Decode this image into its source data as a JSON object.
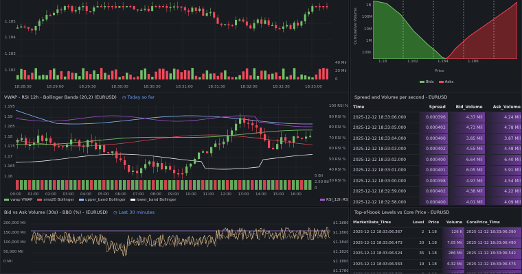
{
  "colors": {
    "up": "#73bf69",
    "down": "#f2495c",
    "vwap": "#73bf69",
    "sma20": "#f2495c",
    "upper": "#8ab8ff",
    "lower": "#ffffff",
    "rsi": "#a352cc",
    "volume": "#e8c89a",
    "cell_hi": "#6a3a94"
  },
  "top_chart": {
    "y_ticks": [
      "1.185",
      "1.184",
      "1.183",
      "1.182"
    ],
    "y_right_ticks": [
      "40 Mil",
      "20 Mil",
      "0"
    ],
    "x_ticks": [
      "18:28:30",
      "18:29:00",
      "18:29:30",
      "18:30:00",
      "18:30:30",
      "18:31:00",
      "18:31:30",
      "18:32:00",
      "18:32:30",
      "18:33:00"
    ]
  },
  "depth_chart": {
    "ylabel": "Cumulative Volume",
    "y_ticks": [
      "1B",
      "100M",
      "10M",
      "1M",
      "100k"
    ],
    "x_ticks": [
      "1.18",
      "1.182",
      "1.184",
      "1.186"
    ],
    "xlabel": "Price",
    "legend": [
      "Bids",
      "Asks"
    ]
  },
  "vwap_panel": {
    "title": "VWAP - RSI 12h - Bollinger Bands (20,2) (EURUSD)",
    "link": "Today so far",
    "y_ticks": [
      "1.195",
      "1.19",
      "1.185",
      "1.18",
      "1.175",
      "1.17",
      "1.165",
      "1.16"
    ],
    "rsi_ticks": [
      "100 RSI %",
      "90 RSI %",
      "80 RSI %",
      "70 RSI %",
      "60 RSI %",
      "50 RSI %",
      "40 RSI %",
      "30 RSI %"
    ],
    "vol_ticks": [
      "5 Bil",
      "2.50 Bil",
      "0"
    ],
    "x_ticks": [
      "00:00",
      "01:00",
      "02:00",
      "03:00",
      "04:00",
      "05:00",
      "06:00",
      "07:00",
      "08:00",
      "09:00",
      "10:00",
      "11:00",
      "12:00",
      "13:00",
      "14:00",
      "15:00",
      "16:00"
    ],
    "legend": [
      "vwap VWAP",
      "sma20 Bollinger",
      "upper_band Bollinger",
      "lower_band Bollinger"
    ],
    "legend_right": "RSI_12h RSI"
  },
  "bidask_panel": {
    "title": "Bid vs Ask Volume (30s) - BBO (%) - (EURUSD)",
    "link": "Last 30 minutes",
    "y_ticks": [
      "200,000 Mil",
      "150,000 Mil",
      "100,000 Mil",
      "50,000 Mil",
      "0 Mil"
    ],
    "y_right_ticks": [
      "$1.1880",
      "$1.1860",
      "$1.1840",
      "$1.1820",
      "$1.1800",
      "$1.1780"
    ]
  },
  "spread_table": {
    "title": "Spread and Volume per second - EURUSD",
    "columns": [
      "Time",
      "Spread",
      "Bid_Volume",
      "Ask_Volume"
    ],
    "rows": [
      [
        "2025-12-12 18:33:06.000",
        "0.000396",
        "4.37 Mil",
        "4.24 Mil"
      ],
      [
        "2025-12-12 18:33:05.000",
        "0.000402",
        "4.73 Mil",
        "4.78 Mil"
      ],
      [
        "2025-12-12 18:33:04.000",
        "0.000400",
        "3.85 Mil",
        "3.87 Mil"
      ],
      [
        "2025-12-12 18:33:03.000",
        "0.000402",
        "4.55 Mil",
        "4.48 Mil"
      ],
      [
        "2025-12-12 18:33:02.000",
        "0.000400",
        "6.64 Mil",
        "6.40 Mil"
      ],
      [
        "2025-12-12 18:33:01.000",
        "0.000401",
        "6.05 Mil",
        "5.91 Mil"
      ],
      [
        "2025-12-12 18:33:00.000",
        "0.000398",
        "4.97 Mil",
        "4.54 Mil"
      ],
      [
        "2025-12-12 18:32:59.000",
        "0.000402",
        "4.38 Mil",
        "4.22 Mil"
      ],
      [
        "2025-12-12 18:32:58.000",
        "0.000400",
        "4.01 Mil",
        "4.09 Mil"
      ]
    ]
  },
  "tob_table": {
    "title": "Top-of-book Levels vs Core Price - EURUSD",
    "columns": [
      "MarketData_Time",
      "Level",
      "Price",
      "Volume",
      "CorePrice_Time"
    ],
    "rows": [
      [
        "2025-12-12 18:33:06.367",
        "2",
        "1.18",
        "126 K",
        "2025-12-12 18:33:06.390"
      ],
      [
        "2025-12-12 18:33:06.473",
        "20",
        "1.18",
        "7.05 Mil",
        "2025-12-12 18:33:06.490"
      ],
      [
        "2025-12-12 18:33:06.524",
        "35",
        "1.18",
        "286 Mil",
        "2025-12-12 18:33:06.542"
      ],
      [
        "2025-12-12 18:33:06.563",
        "19",
        "1.18",
        "6.32 Mil",
        "2025-12-12 18:33:06.576"
      ],
      [
        "2025-12-12 18:33:06.703",
        "2",
        "1.18",
        "106 K",
        "2025-12-12 18:33:06.721"
      ]
    ]
  }
}
